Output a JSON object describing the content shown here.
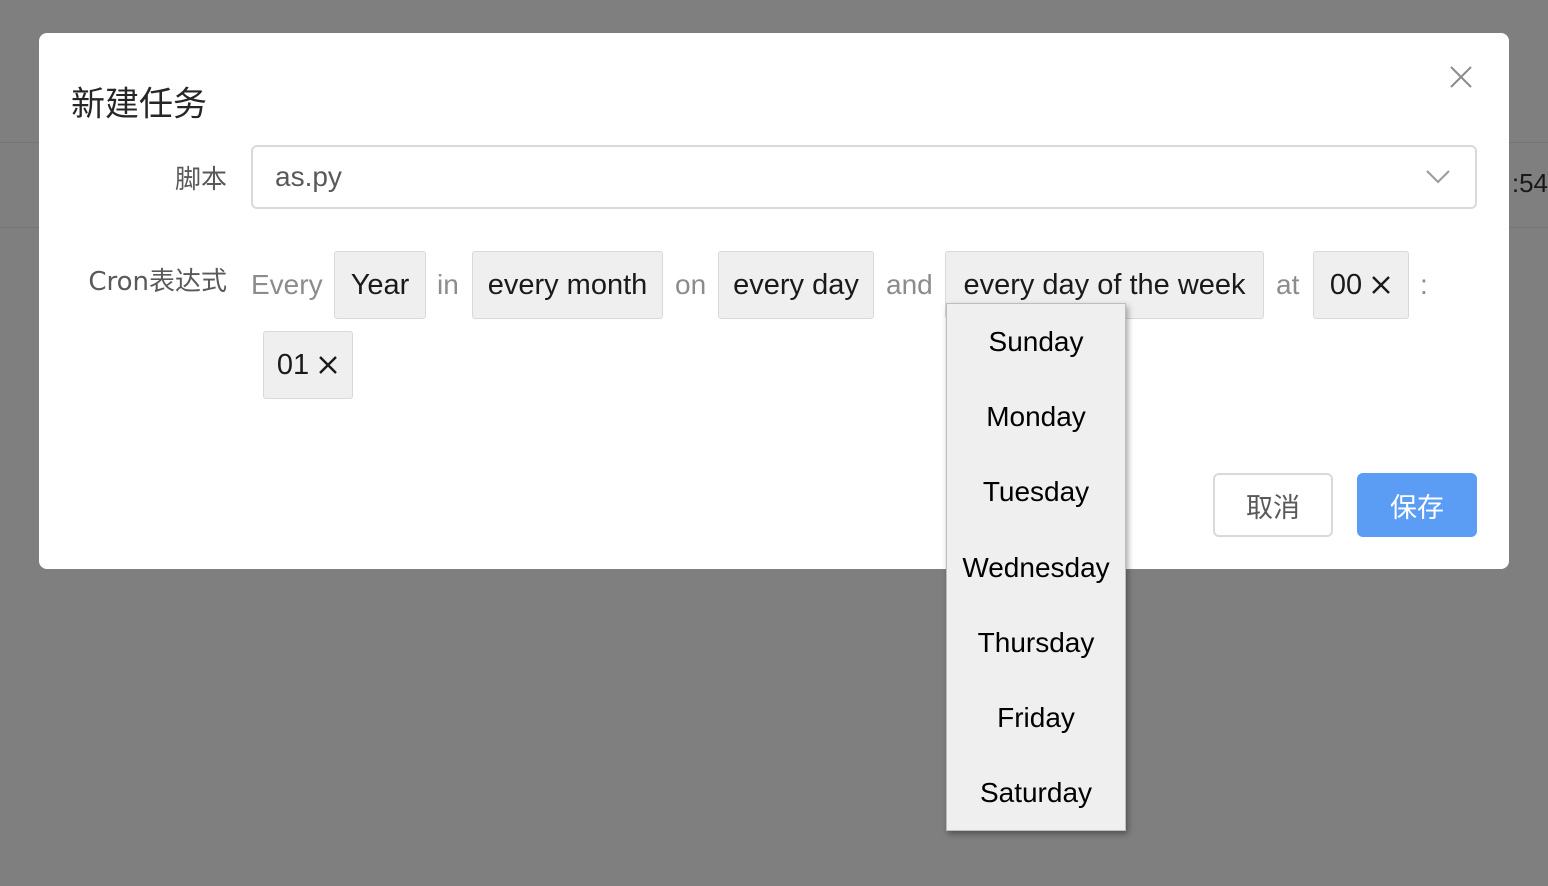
{
  "background": {
    "partial_time": ":54"
  },
  "modal": {
    "title": "新建任务",
    "close_icon": "close-icon",
    "script_label": "脚本",
    "script_value": "as.py",
    "cron_label": "Cron表达式",
    "cron": {
      "word_every": "Every",
      "period": "Year",
      "word_in": "in",
      "month": "every month",
      "word_on": "on",
      "day": "every day",
      "word_and": "and",
      "weekday": "every day of the week",
      "word_at": "at",
      "hour": "00",
      "colon": ":",
      "minute": "01"
    },
    "cancel_label": "取消",
    "save_label": "保存"
  },
  "weekday_dropdown": {
    "items": [
      "Sunday",
      "Monday",
      "Tuesday",
      "Wednesday",
      "Thursday",
      "Friday",
      "Saturday"
    ]
  },
  "colors": {
    "primary": "#5b9cf5",
    "mask": "rgba(0,0,0,0.5)"
  }
}
